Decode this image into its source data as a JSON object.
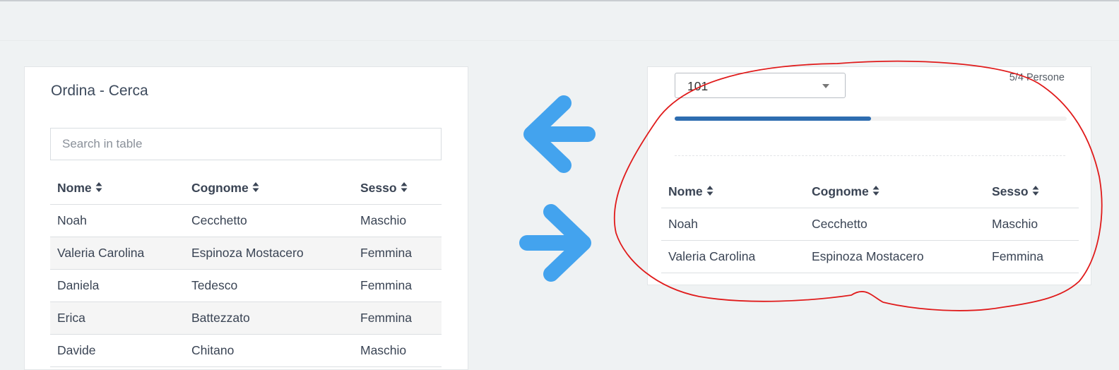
{
  "left_panel": {
    "title": "Ordina - Cerca",
    "search_placeholder": "Search in table",
    "columns": [
      "Nome",
      "Cognome",
      "Sesso"
    ],
    "rows": [
      [
        "Noah",
        "Cecchetto",
        "Maschio"
      ],
      [
        "Valeria Carolina",
        "Espinoza Mostacero",
        "Femmina"
      ],
      [
        "Daniela",
        "Tedesco",
        "Femmina"
      ],
      [
        "Erica",
        "Battezzato",
        "Femmina"
      ],
      [
        "Davide",
        "Chitano",
        "Maschio"
      ]
    ]
  },
  "right_panel": {
    "select_value": "101",
    "count_label": "5/4 Persone",
    "progress": 0.5,
    "columns": [
      "Nome",
      "Cognome",
      "Sesso"
    ],
    "rows": [
      [
        "Noah",
        "Cecchetto",
        "Maschio"
      ],
      [
        "Valeria Carolina",
        "Espinoza Mostacero",
        "Femmina"
      ]
    ]
  },
  "colors": {
    "arrow": "#43a3ee",
    "annotation": "#e01b1b",
    "progress": "#2e6db0"
  },
  "icons": {
    "arrow_left": "arrow-left-icon",
    "arrow_right": "arrow-right-icon",
    "sort": "sort-icon",
    "caret": "caret-down-icon"
  }
}
